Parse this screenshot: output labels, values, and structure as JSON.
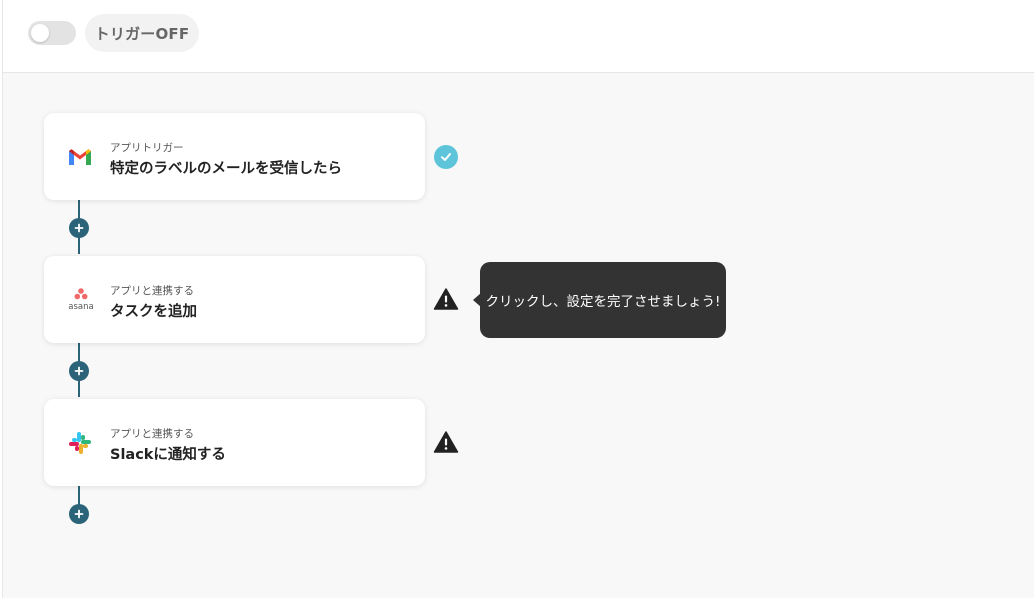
{
  "header": {
    "trigger_toggle_state": "off",
    "trigger_label": "トリガーOFF"
  },
  "flow": {
    "steps": [
      {
        "kind": "アプリトリガー",
        "title": "特定のラベルのメールを受信したら",
        "app_icon": "gmail-icon",
        "status": "complete",
        "status_icon": "check-circle-icon"
      },
      {
        "kind": "アプリと連携する",
        "title": "タスクを追加",
        "app_icon": "asana-icon",
        "app_icon_text": "asana",
        "status": "incomplete",
        "status_icon": "warning-icon"
      },
      {
        "kind": "アプリと連携する",
        "title": "Slackに通知する",
        "app_icon": "slack-icon",
        "status": "incomplete",
        "status_icon": "warning-icon"
      }
    ],
    "add_button_icon": "plus-icon"
  },
  "tooltip": {
    "text": "クリックし、設定を完了させましょう!"
  },
  "colors": {
    "connector": "#2b6478",
    "check": "#5dc4d9",
    "tooltip_bg": "#333333",
    "canvas_bg": "#f8f8f8"
  }
}
